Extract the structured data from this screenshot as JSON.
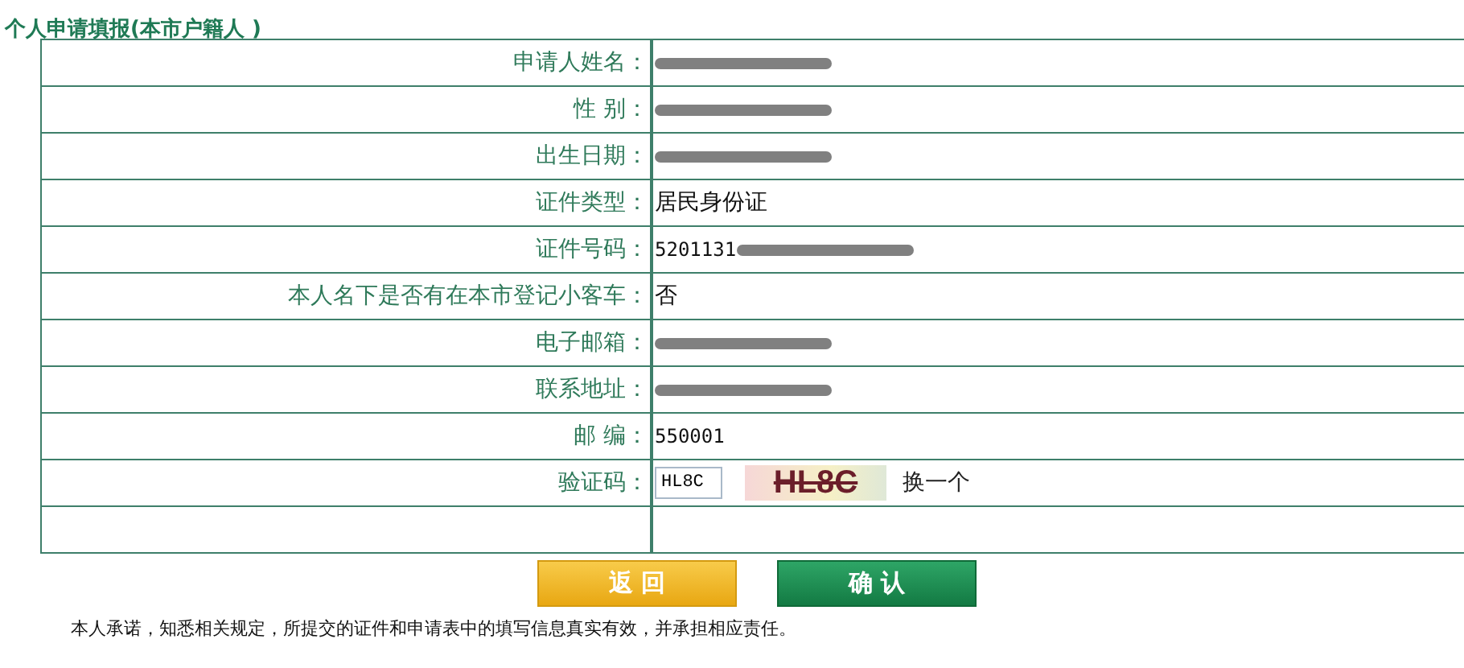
{
  "title": "个人申请填报(本市户籍人 )",
  "rows": [
    {
      "kind": "text",
      "label": "申请人姓名：",
      "value": "",
      "redacted": true
    },
    {
      "kind": "text",
      "label": "性 别：",
      "value": "",
      "redacted": true
    },
    {
      "kind": "text",
      "label": "出生日期：",
      "value": "",
      "redacted": true
    },
    {
      "kind": "text",
      "label": "证件类型：",
      "value": "居民身份证",
      "redacted": false
    },
    {
      "kind": "text",
      "label": "证件号码：",
      "value": "5201131",
      "redacted": true
    },
    {
      "kind": "text",
      "label": "本人名下是否有在本市登记小客车：",
      "value": "否",
      "redacted": false
    },
    {
      "kind": "text",
      "label": "电子邮箱：",
      "value": "",
      "redacted": true
    },
    {
      "kind": "text",
      "label": "联系地址：",
      "value": "",
      "redacted": true
    },
    {
      "kind": "text",
      "label": "邮 编：",
      "value": "550001",
      "redacted": false
    },
    {
      "kind": "captcha",
      "label": "验证码：",
      "value": "HL8C",
      "image_text": "HL8C",
      "refresh": "换一个"
    },
    {
      "kind": "empty"
    }
  ],
  "buttons": [
    {
      "label": "返 回",
      "kind": "back"
    },
    {
      "label": "确 认",
      "kind": "confirm"
    }
  ],
  "notice": "本人承诺，知悉相关规定，所提交的证件和申请表中的填写信息真实有效，并承担相应责任。"
}
